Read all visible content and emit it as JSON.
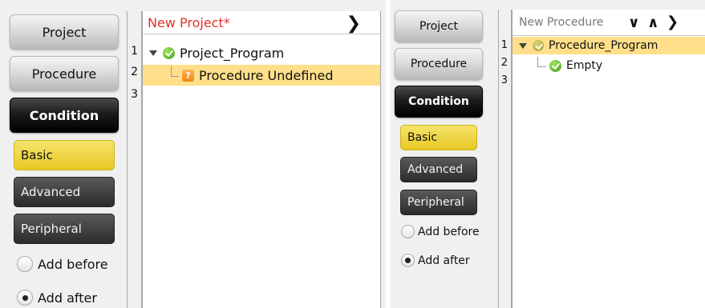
{
  "left": {
    "sidebar": {
      "buttons": [
        "Project",
        "Procedure",
        "Condition"
      ],
      "subs": [
        "Basic",
        "Advanced",
        "Peripheral"
      ],
      "radios": [
        "Add before",
        "Add after"
      ],
      "selected_radio": "Add after"
    },
    "editor": {
      "title": "New Project*",
      "title_color": "#e0302a",
      "line_numbers": [
        "1",
        "2",
        "3"
      ],
      "tree": {
        "root": "Project_Program",
        "child": "Procedure Undefined"
      }
    }
  },
  "right": {
    "sidebar": {
      "buttons": [
        "Project",
        "Procedure",
        "Condition"
      ],
      "subs": [
        "Basic",
        "Advanced",
        "Peripheral"
      ],
      "radios": [
        "Add before",
        "Add after"
      ],
      "selected_radio": "Add after"
    },
    "editor": {
      "title": "New Procedure",
      "line_numbers": [
        "1",
        "2",
        "3"
      ],
      "tree": {
        "root": "Procedure_Program",
        "child": "Empty"
      }
    }
  },
  "colors": {
    "selected_row": "#ffdf8a",
    "basic_highlight": "#e7c825"
  }
}
